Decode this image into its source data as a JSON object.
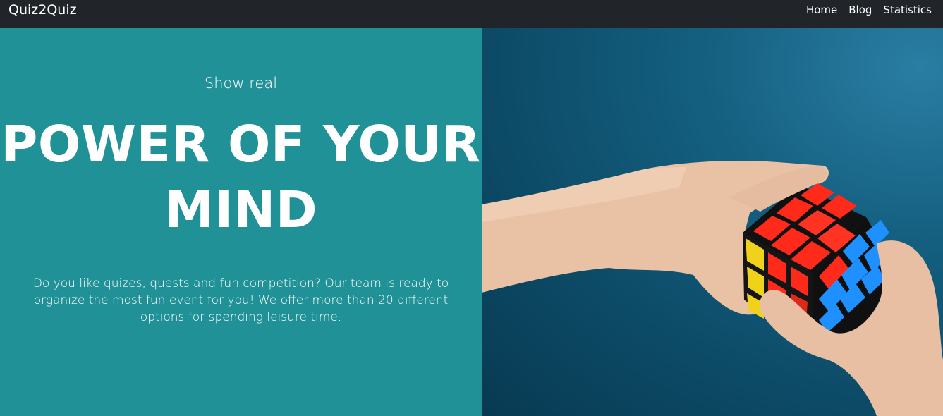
{
  "navbar": {
    "brand": "Quiz2Quiz",
    "links": [
      {
        "label": "Home"
      },
      {
        "label": "Blog"
      },
      {
        "label": "Statistics"
      }
    ]
  },
  "hero": {
    "subtitle": "Show real",
    "headline_line1": "POWER OF YOUR",
    "headline_line2": "MIND",
    "description": "Do you like quizes, quests and fun competition? Our team is ready to organize the most fun event for you! We offer more than 20 different options for spending leisure time.",
    "left_background": "#209196",
    "right_background": "#0f5273"
  },
  "image": {
    "subject": "hands-holding-rubiks-cube"
  }
}
